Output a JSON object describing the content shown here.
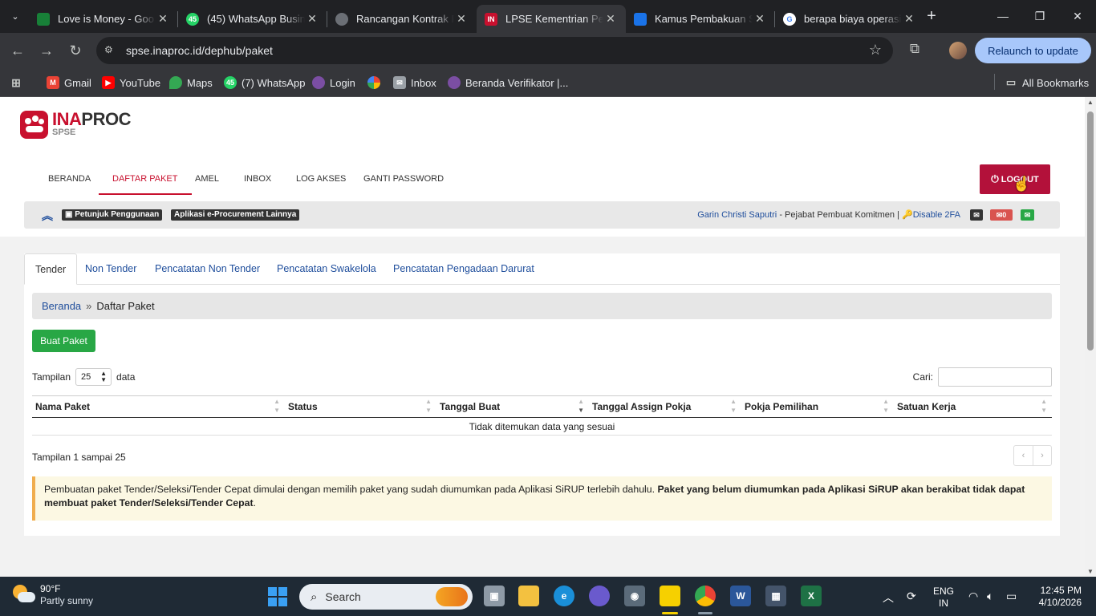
{
  "browser": {
    "tabs": [
      {
        "title": "Love is Money - Goo",
        "favicon": "sheets-icon",
        "color": "#188038",
        "letter": ""
      },
      {
        "title": "(45) WhatsApp Busin",
        "favicon": "whatsapp-icon",
        "color": "#25d366",
        "letter": "45"
      },
      {
        "title": "Rancangan Kontrak P",
        "favicon": "globe-icon",
        "color": "#6b6f75",
        "letter": ""
      },
      {
        "title": "LPSE Kementrian Per",
        "favicon": "lpse-icon",
        "color": "#c8102e",
        "letter": "IN"
      },
      {
        "title": "Kamus Pembakuan S",
        "favicon": "kamus-icon",
        "color": "#1a73e8",
        "letter": ""
      },
      {
        "title": "berapa biaya operasi",
        "favicon": "google-icon",
        "color": "#ffffff",
        "letter": "G"
      }
    ],
    "active_tab": 3,
    "url": "spse.inaproc.id/dephub/paket",
    "relaunch_label": "Relaunch to update",
    "bookmarks": [
      {
        "label": "Gmail",
        "icon": "gmail-icon",
        "color": "#ea4335"
      },
      {
        "label": "YouTube",
        "icon": "youtube-icon",
        "color": "#ff0000"
      },
      {
        "label": "Maps",
        "icon": "maps-icon",
        "color": "#34a853"
      },
      {
        "label": "(7) WhatsApp",
        "icon": "whatsapp-icon",
        "color": "#25d366"
      },
      {
        "label": "Login",
        "icon": "login-icon",
        "color": "#7b4ea3"
      },
      {
        "label": "",
        "icon": "pinwheel-icon",
        "color": "#fbbc05"
      },
      {
        "label": "Inbox",
        "icon": "mail-icon",
        "color": "#9aa0a6"
      },
      {
        "label": "Beranda Verifikator |...",
        "icon": "verifikator-icon",
        "color": "#7b4ea3"
      }
    ],
    "all_bookmarks_label": "All Bookmarks"
  },
  "site": {
    "logo_ina": "INA",
    "logo_proc": "PROC",
    "logo_sub": "SPSE",
    "nav": [
      "BERANDA",
      "DAFTAR PAKET",
      "AMEL",
      "INBOX",
      "LOG AKSES",
      "GANTI PASSWORD"
    ],
    "nav_active": 1,
    "logout_label": "LOGOUT",
    "info_badges": [
      "Petunjuk Penggunaan",
      "Aplikasi e-Procurement Lainnya"
    ],
    "user_name": "Garin Christi Saputri",
    "user_role": " - Pejabat Pembuat Komitmen | ",
    "disable_2fa": "Disable 2FA",
    "mail_count": "0"
  },
  "content": {
    "subtabs": [
      "Tender",
      "Non Tender",
      "Pencatatan Non Tender",
      "Pencatatan Swakelola",
      "Pencatatan Pengadaan Darurat"
    ],
    "subtab_active": 0,
    "breadcrumb_home": "Beranda",
    "breadcrumb_sep": "»",
    "breadcrumb_current": "Daftar Paket",
    "create_button": "Buat Paket",
    "length_prefix": "Tampilan",
    "length_value": "25",
    "length_suffix": "data",
    "search_label": "Cari:",
    "columns": [
      "Nama Paket",
      "Status",
      "Tanggal Buat",
      "Tanggal Assign Pokja",
      "Pokja Pemilihan",
      "Satuan Kerja"
    ],
    "sorted_column": 2,
    "empty_text": "Tidak ditemukan data yang sesuai",
    "table_info": "Tampilan 1 sampai 25",
    "pager_prev": "‹",
    "pager_next": "›",
    "alert_normal": "Pembuatan paket Tender/Seleksi/Tender Cepat dimulai dengan memilih paket yang sudah diumumkan pada Aplikasi SiRUP terlebih dahulu. ",
    "alert_bold": "Paket yang belum diumumkan pada Aplikasi SiRUP akan berakibat tidak dapat membuat paket Tender/Seleksi/Tender Cepat",
    "alert_end": "."
  },
  "taskbar": {
    "temperature": "90°F",
    "weather": "Partly sunny",
    "search_placeholder": "Search",
    "lang_1": "ENG",
    "lang_2": "IN",
    "time": "12:45 PM",
    "date": "4/10/2026"
  }
}
